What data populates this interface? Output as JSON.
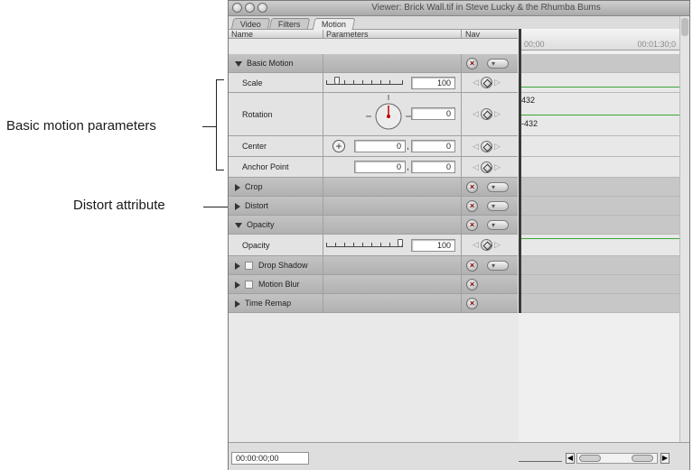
{
  "callouts": {
    "basic_motion": "Basic motion parameters",
    "distort": "Distort attribute"
  },
  "window": {
    "title": "Viewer: Brick Wall.tif in Steve Lucky & the Rhumba Bums",
    "tabs": [
      "Video",
      "Filters",
      "Motion"
    ],
    "active_tab": "Motion"
  },
  "columns": {
    "name": "Name",
    "parameters": "Parameters",
    "nav": "Nav"
  },
  "timeline": {
    "start_tc": "00;00",
    "end_tc": "00:01:30;0",
    "max_label": "432",
    "min_label": "-432"
  },
  "rows": {
    "basic_motion": "Basic Motion",
    "scale": {
      "label": "Scale",
      "value": "100",
      "level": 0.12
    },
    "rotation": {
      "label": "Rotation",
      "value": "0"
    },
    "center": {
      "label": "Center",
      "x": "0",
      "y": "0"
    },
    "anchor_point": {
      "label": "Anchor Point",
      "x": "0",
      "y": "0"
    },
    "crop": "Crop",
    "distort": "Distort",
    "opacity_group": "Opacity",
    "opacity": {
      "label": "Opacity",
      "value": "100",
      "level": 1.0
    },
    "drop_shadow": "Drop Shadow",
    "motion_blur": "Motion Blur",
    "time_remap": "Time Remap"
  },
  "status": {
    "timecode": "00:00:00;00"
  },
  "icons": {
    "reset": "reset-x-icon",
    "menu": "popup-menu-icon",
    "keyframe": "keyframe-diamond-icon",
    "center_target": "crosshair-icon"
  }
}
